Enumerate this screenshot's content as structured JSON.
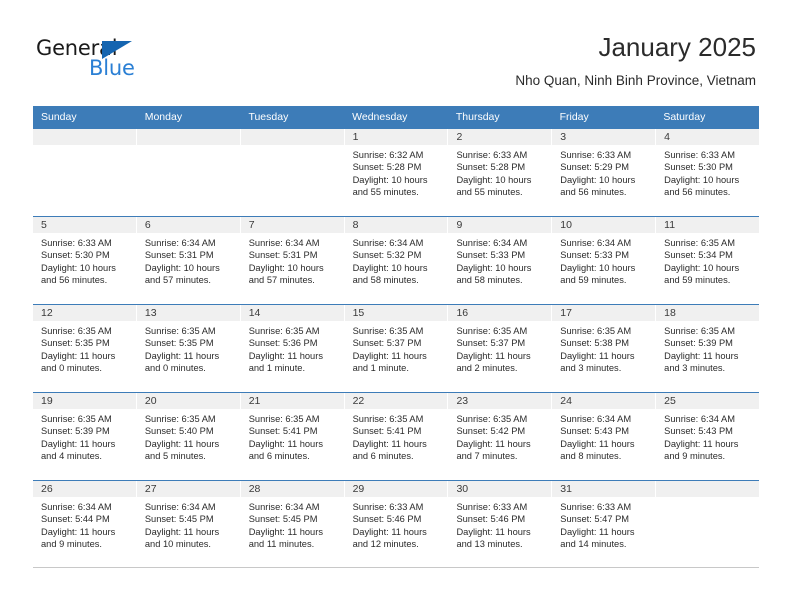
{
  "brand": {
    "name_part1": "General",
    "name_part2": "Blue",
    "triangle_icon": "triangle-icon",
    "accent_color": "#1565b0",
    "blue_color": "#2a7fd4"
  },
  "header": {
    "title": "January 2025",
    "subtitle": "Nho Quan, Ninh Binh Province, Vietnam"
  },
  "theme": {
    "header_row_color": "#3d7cb8",
    "day_header_bg": "#f0f0f0",
    "text_color": "#2b2b2b"
  },
  "weekdays": [
    "Sunday",
    "Monday",
    "Tuesday",
    "Wednesday",
    "Thursday",
    "Friday",
    "Saturday"
  ],
  "weeks": [
    [
      {
        "date": "",
        "sunrise": "",
        "sunset": "",
        "daylight1": "",
        "daylight2": "",
        "empty": true
      },
      {
        "date": "",
        "sunrise": "",
        "sunset": "",
        "daylight1": "",
        "daylight2": "",
        "empty": true
      },
      {
        "date": "",
        "sunrise": "",
        "sunset": "",
        "daylight1": "",
        "daylight2": "",
        "empty": true
      },
      {
        "date": "1",
        "sunrise": "Sunrise: 6:32 AM",
        "sunset": "Sunset: 5:28 PM",
        "daylight1": "Daylight: 10 hours",
        "daylight2": "and 55 minutes."
      },
      {
        "date": "2",
        "sunrise": "Sunrise: 6:33 AM",
        "sunset": "Sunset: 5:28 PM",
        "daylight1": "Daylight: 10 hours",
        "daylight2": "and 55 minutes."
      },
      {
        "date": "3",
        "sunrise": "Sunrise: 6:33 AM",
        "sunset": "Sunset: 5:29 PM",
        "daylight1": "Daylight: 10 hours",
        "daylight2": "and 56 minutes."
      },
      {
        "date": "4",
        "sunrise": "Sunrise: 6:33 AM",
        "sunset": "Sunset: 5:30 PM",
        "daylight1": "Daylight: 10 hours",
        "daylight2": "and 56 minutes."
      }
    ],
    [
      {
        "date": "5",
        "sunrise": "Sunrise: 6:33 AM",
        "sunset": "Sunset: 5:30 PM",
        "daylight1": "Daylight: 10 hours",
        "daylight2": "and 56 minutes."
      },
      {
        "date": "6",
        "sunrise": "Sunrise: 6:34 AM",
        "sunset": "Sunset: 5:31 PM",
        "daylight1": "Daylight: 10 hours",
        "daylight2": "and 57 minutes."
      },
      {
        "date": "7",
        "sunrise": "Sunrise: 6:34 AM",
        "sunset": "Sunset: 5:31 PM",
        "daylight1": "Daylight: 10 hours",
        "daylight2": "and 57 minutes."
      },
      {
        "date": "8",
        "sunrise": "Sunrise: 6:34 AM",
        "sunset": "Sunset: 5:32 PM",
        "daylight1": "Daylight: 10 hours",
        "daylight2": "and 58 minutes."
      },
      {
        "date": "9",
        "sunrise": "Sunrise: 6:34 AM",
        "sunset": "Sunset: 5:33 PM",
        "daylight1": "Daylight: 10 hours",
        "daylight2": "and 58 minutes."
      },
      {
        "date": "10",
        "sunrise": "Sunrise: 6:34 AM",
        "sunset": "Sunset: 5:33 PM",
        "daylight1": "Daylight: 10 hours",
        "daylight2": "and 59 minutes."
      },
      {
        "date": "11",
        "sunrise": "Sunrise: 6:35 AM",
        "sunset": "Sunset: 5:34 PM",
        "daylight1": "Daylight: 10 hours",
        "daylight2": "and 59 minutes."
      }
    ],
    [
      {
        "date": "12",
        "sunrise": "Sunrise: 6:35 AM",
        "sunset": "Sunset: 5:35 PM",
        "daylight1": "Daylight: 11 hours",
        "daylight2": "and 0 minutes."
      },
      {
        "date": "13",
        "sunrise": "Sunrise: 6:35 AM",
        "sunset": "Sunset: 5:35 PM",
        "daylight1": "Daylight: 11 hours",
        "daylight2": "and 0 minutes."
      },
      {
        "date": "14",
        "sunrise": "Sunrise: 6:35 AM",
        "sunset": "Sunset: 5:36 PM",
        "daylight1": "Daylight: 11 hours",
        "daylight2": "and 1 minute."
      },
      {
        "date": "15",
        "sunrise": "Sunrise: 6:35 AM",
        "sunset": "Sunset: 5:37 PM",
        "daylight1": "Daylight: 11 hours",
        "daylight2": "and 1 minute."
      },
      {
        "date": "16",
        "sunrise": "Sunrise: 6:35 AM",
        "sunset": "Sunset: 5:37 PM",
        "daylight1": "Daylight: 11 hours",
        "daylight2": "and 2 minutes."
      },
      {
        "date": "17",
        "sunrise": "Sunrise: 6:35 AM",
        "sunset": "Sunset: 5:38 PM",
        "daylight1": "Daylight: 11 hours",
        "daylight2": "and 3 minutes."
      },
      {
        "date": "18",
        "sunrise": "Sunrise: 6:35 AM",
        "sunset": "Sunset: 5:39 PM",
        "daylight1": "Daylight: 11 hours",
        "daylight2": "and 3 minutes."
      }
    ],
    [
      {
        "date": "19",
        "sunrise": "Sunrise: 6:35 AM",
        "sunset": "Sunset: 5:39 PM",
        "daylight1": "Daylight: 11 hours",
        "daylight2": "and 4 minutes."
      },
      {
        "date": "20",
        "sunrise": "Sunrise: 6:35 AM",
        "sunset": "Sunset: 5:40 PM",
        "daylight1": "Daylight: 11 hours",
        "daylight2": "and 5 minutes."
      },
      {
        "date": "21",
        "sunrise": "Sunrise: 6:35 AM",
        "sunset": "Sunset: 5:41 PM",
        "daylight1": "Daylight: 11 hours",
        "daylight2": "and 6 minutes."
      },
      {
        "date": "22",
        "sunrise": "Sunrise: 6:35 AM",
        "sunset": "Sunset: 5:41 PM",
        "daylight1": "Daylight: 11 hours",
        "daylight2": "and 6 minutes."
      },
      {
        "date": "23",
        "sunrise": "Sunrise: 6:35 AM",
        "sunset": "Sunset: 5:42 PM",
        "daylight1": "Daylight: 11 hours",
        "daylight2": "and 7 minutes."
      },
      {
        "date": "24",
        "sunrise": "Sunrise: 6:34 AM",
        "sunset": "Sunset: 5:43 PM",
        "daylight1": "Daylight: 11 hours",
        "daylight2": "and 8 minutes."
      },
      {
        "date": "25",
        "sunrise": "Sunrise: 6:34 AM",
        "sunset": "Sunset: 5:43 PM",
        "daylight1": "Daylight: 11 hours",
        "daylight2": "and 9 minutes."
      }
    ],
    [
      {
        "date": "26",
        "sunrise": "Sunrise: 6:34 AM",
        "sunset": "Sunset: 5:44 PM",
        "daylight1": "Daylight: 11 hours",
        "daylight2": "and 9 minutes."
      },
      {
        "date": "27",
        "sunrise": "Sunrise: 6:34 AM",
        "sunset": "Sunset: 5:45 PM",
        "daylight1": "Daylight: 11 hours",
        "daylight2": "and 10 minutes."
      },
      {
        "date": "28",
        "sunrise": "Sunrise: 6:34 AM",
        "sunset": "Sunset: 5:45 PM",
        "daylight1": "Daylight: 11 hours",
        "daylight2": "and 11 minutes."
      },
      {
        "date": "29",
        "sunrise": "Sunrise: 6:33 AM",
        "sunset": "Sunset: 5:46 PM",
        "daylight1": "Daylight: 11 hours",
        "daylight2": "and 12 minutes."
      },
      {
        "date": "30",
        "sunrise": "Sunrise: 6:33 AM",
        "sunset": "Sunset: 5:46 PM",
        "daylight1": "Daylight: 11 hours",
        "daylight2": "and 13 minutes."
      },
      {
        "date": "31",
        "sunrise": "Sunrise: 6:33 AM",
        "sunset": "Sunset: 5:47 PM",
        "daylight1": "Daylight: 11 hours",
        "daylight2": "and 14 minutes."
      },
      {
        "date": "",
        "sunrise": "",
        "sunset": "",
        "daylight1": "",
        "daylight2": "",
        "empty": true
      }
    ]
  ]
}
